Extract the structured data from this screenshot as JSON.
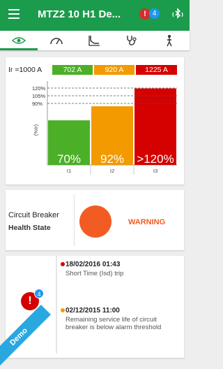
{
  "app": {
    "title": "MTZ2 10 H1 De...",
    "alert_mark": "!",
    "notification_count": "4"
  },
  "tabs": [
    {
      "icon": "eye-icon",
      "active": true
    },
    {
      "icon": "gauge-icon",
      "active": false
    },
    {
      "icon": "trip-curve-icon",
      "active": false
    },
    {
      "icon": "stethoscope-icon",
      "active": false
    },
    {
      "icon": "maintenance-icon",
      "active": false
    }
  ],
  "load_card": {
    "ir_label": "Ir =1000 A",
    "current_boxes": [
      {
        "value": "702 A",
        "color": "#4caf28"
      },
      {
        "value": "920 A",
        "color": "#f29a00"
      },
      {
        "value": "1225 A",
        "color": "#d50000"
      }
    ],
    "y_ticks": [
      "120%",
      "105%",
      "90%"
    ],
    "y_axis_label": "(%Ir)"
  },
  "chart_data": {
    "type": "bar",
    "categories": [
      "I1",
      "I2",
      "I3"
    ],
    "values": [
      70,
      92,
      120
    ],
    "data_labels": [
      "70%",
      "92%",
      ">120%"
    ],
    "colors": [
      "#4caf28",
      "#f29a00",
      "#d50000"
    ],
    "ylabel": "(%Ir)",
    "reference_lines": [
      120,
      105,
      90
    ],
    "ylim": [
      0,
      125
    ]
  },
  "health_card": {
    "title": "Circuit Breaker",
    "subtitle": "Health State",
    "status": "WARNING",
    "status_color": "#f25c22"
  },
  "events_card": {
    "badge_count": "4",
    "alert_mark": "!",
    "events": [
      {
        "date": "18/02/2016 01:43",
        "description": "Short Time (Isd) trip",
        "color": "#d50000"
      },
      {
        "date": "02/12/2015 11:00",
        "description_lines": [
          "Remaining service life of circuit",
          "breaker is below alarm threshold"
        ],
        "color": "#f29a00"
      }
    ]
  },
  "ribbon": {
    "label": "Demo"
  }
}
